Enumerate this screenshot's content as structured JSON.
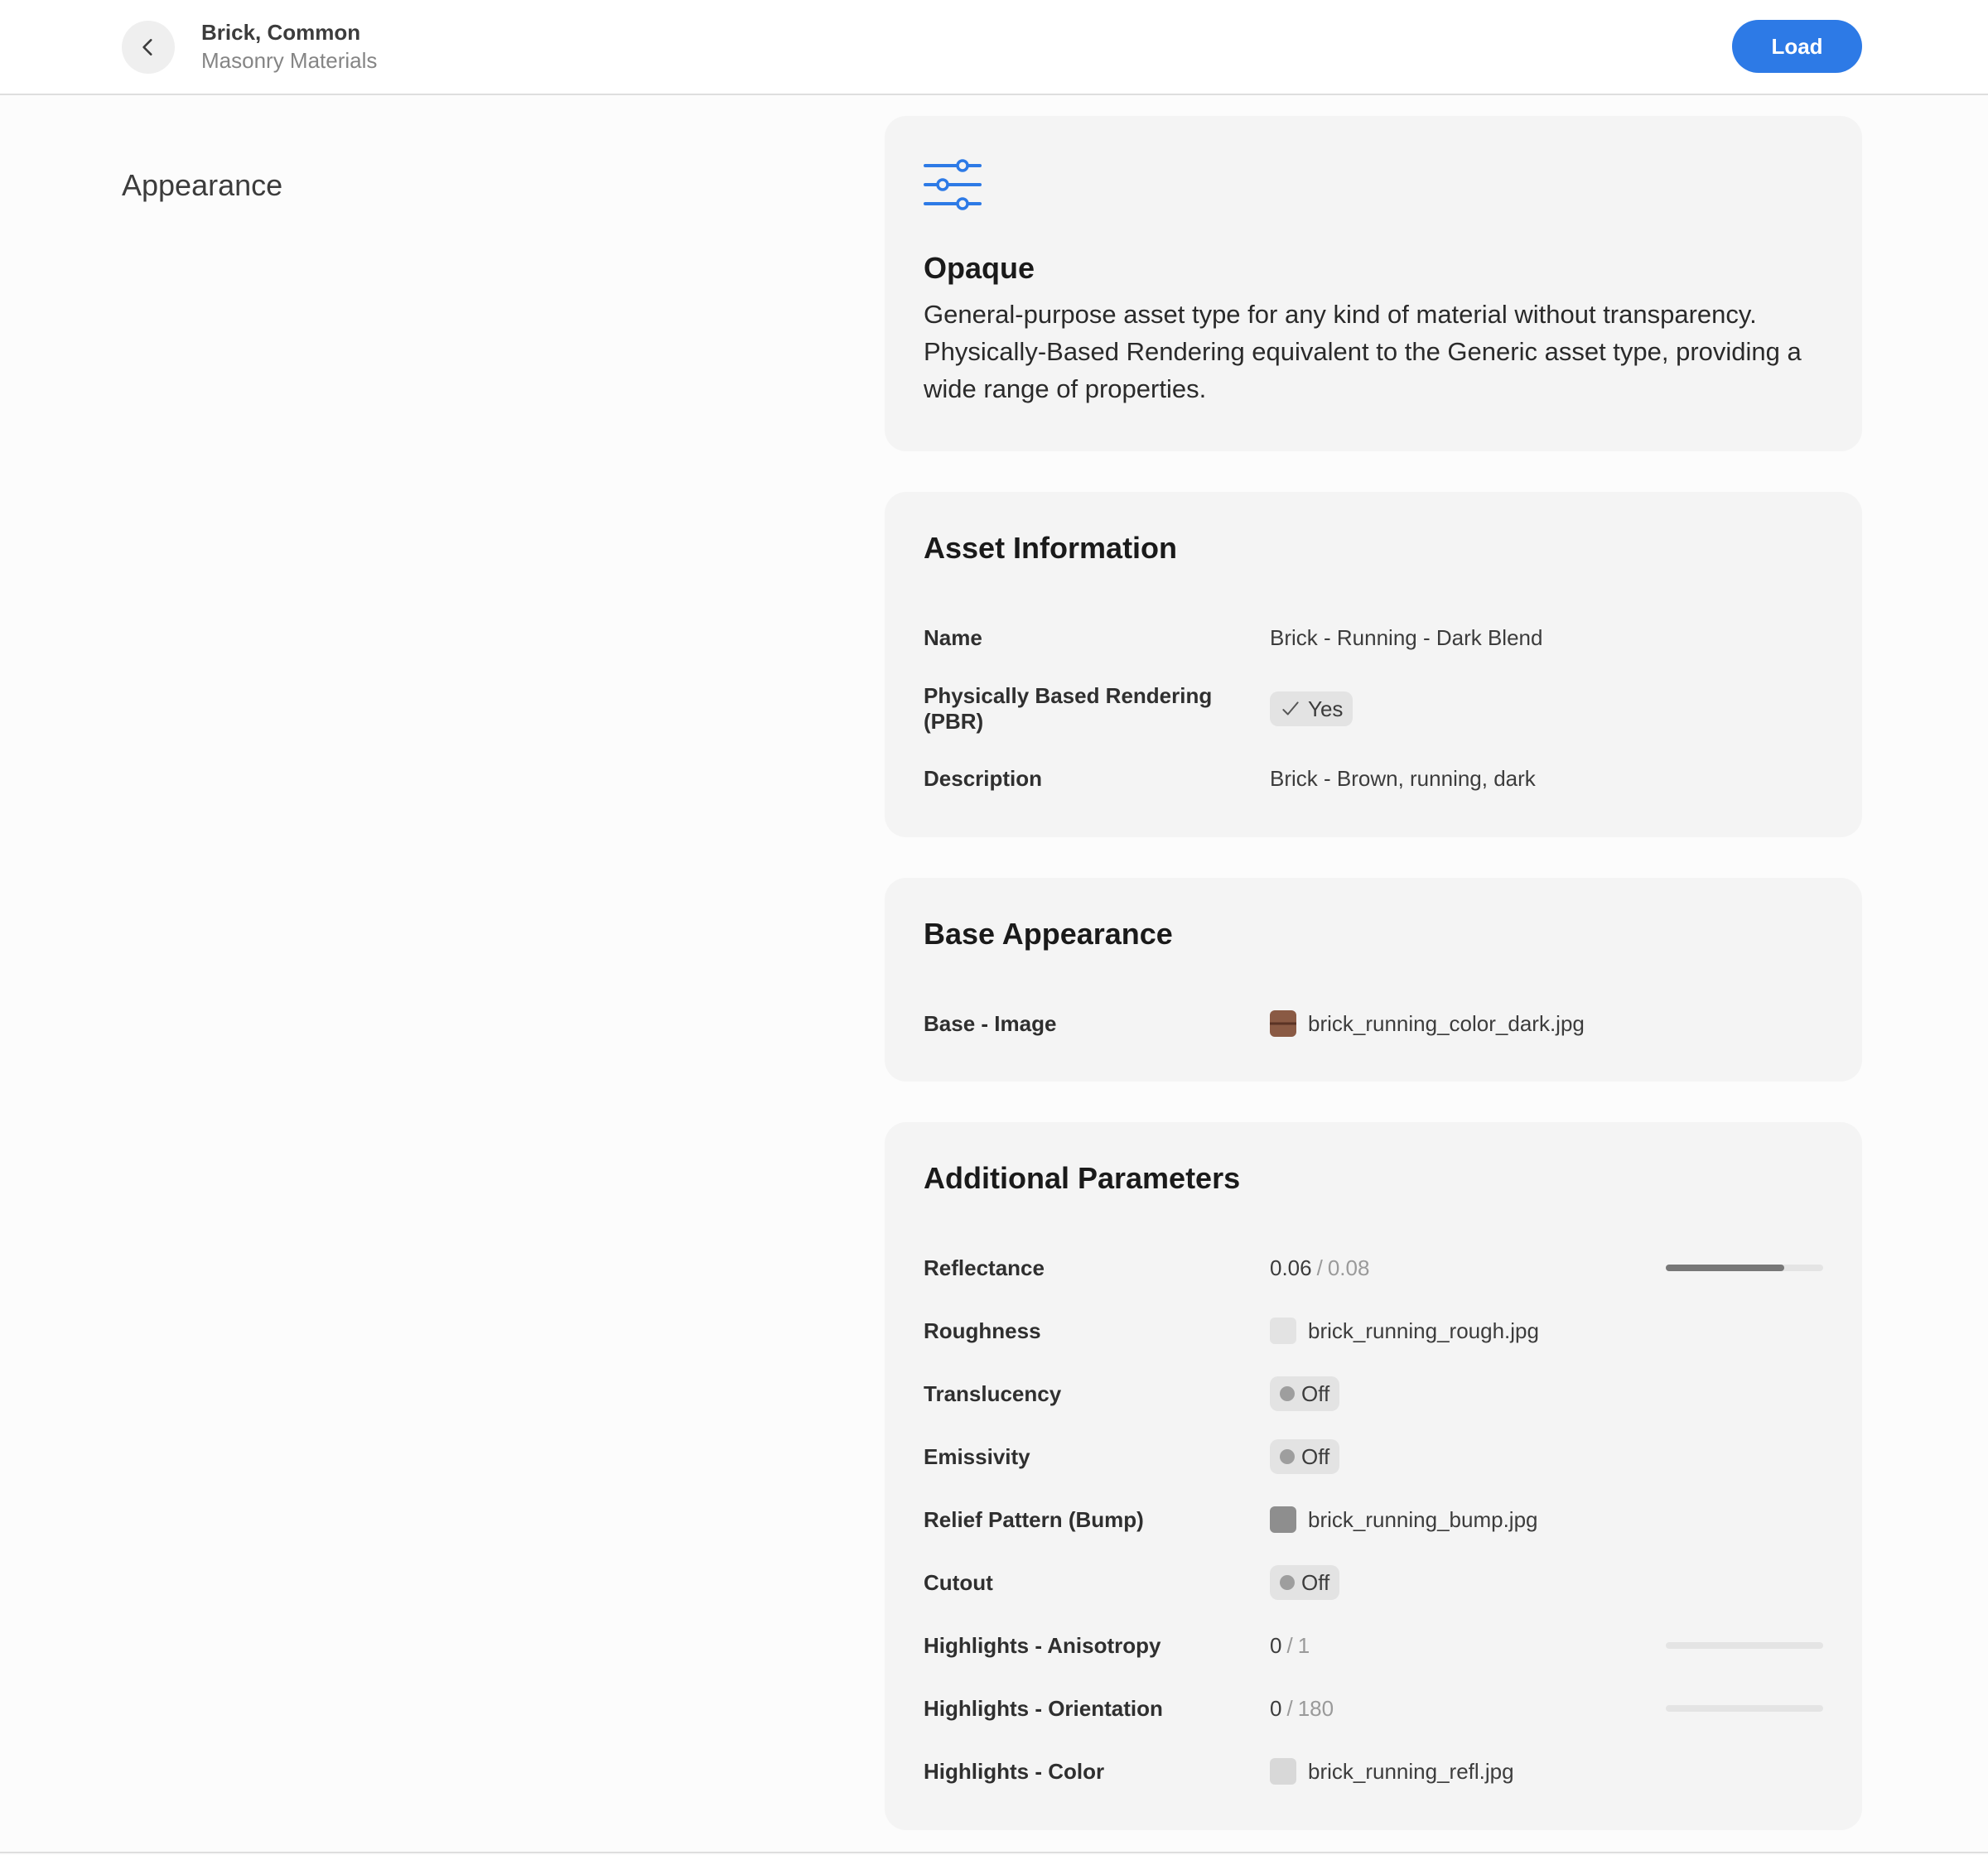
{
  "header": {
    "title": "Brick, Common",
    "subtitle": "Masonry Materials",
    "load_label": "Load"
  },
  "section_label": "Appearance",
  "type_card": {
    "icon": "sliders-icon",
    "title": "Opaque",
    "description": "General-purpose asset type for any kind of material without transparency. Physically-Based Rendering equivalent to the Generic asset type, providing a wide range of properties."
  },
  "asset_info": {
    "title": "Asset Information",
    "rows": [
      {
        "label": "Name",
        "value": "Brick - Running - Dark Blend"
      },
      {
        "label": "Physically Based Rendering (PBR)",
        "value": "Yes"
      },
      {
        "label": "Description",
        "value": "Brick - Brown, running, dark"
      }
    ]
  },
  "base_appearance": {
    "title": "Base Appearance",
    "rows": [
      {
        "label": "Base - Image",
        "value": "brick_running_color_dark.jpg"
      }
    ]
  },
  "additional": {
    "title": "Additional Parameters",
    "reflectance": {
      "label": "Reflectance",
      "value": "0.06",
      "sep": "/",
      "max": "0.08",
      "fraction": 0.75
    },
    "roughness": {
      "label": "Roughness",
      "value": "brick_running_rough.jpg"
    },
    "translucency": {
      "label": "Translucency",
      "value": "Off"
    },
    "emissivity": {
      "label": "Emissivity",
      "value": "Off"
    },
    "relief": {
      "label": "Relief Pattern (Bump)",
      "value": "brick_running_bump.jpg"
    },
    "cutout": {
      "label": "Cutout",
      "value": "Off"
    },
    "anisotropy": {
      "label": "Highlights - Anisotropy",
      "value": "0",
      "sep": "/",
      "max": "1",
      "fraction": 0
    },
    "orientation": {
      "label": "Highlights - Orientation",
      "value": "0",
      "sep": "/",
      "max": "180",
      "fraction": 0
    },
    "color": {
      "label": "Highlights - Color",
      "value": "brick_running_refl.jpg"
    }
  },
  "colors": {
    "accent": "#2d7ae6",
    "card_bg": "#f4f4f4",
    "icon_blue": "#2d7ae6"
  }
}
